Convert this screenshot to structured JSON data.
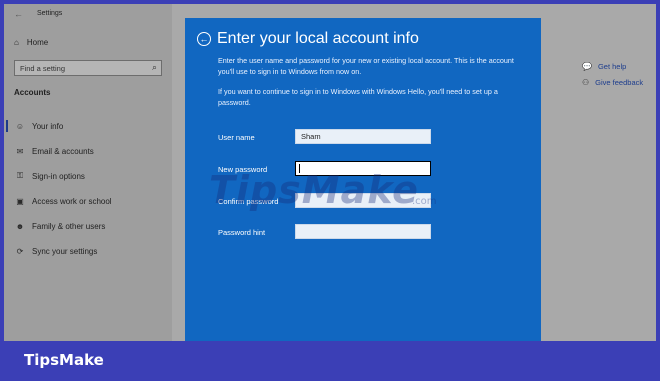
{
  "window": {
    "title": "Settings"
  },
  "sidebar": {
    "home_label": "Home",
    "search_placeholder": "Find a setting",
    "section_title": "Accounts",
    "items": [
      {
        "label": "Your info",
        "icon": "person-icon"
      },
      {
        "label": "Email & accounts",
        "icon": "email-icon"
      },
      {
        "label": "Sign-in options",
        "icon": "key-icon"
      },
      {
        "label": "Access work or school",
        "icon": "briefcase-icon"
      },
      {
        "label": "Family & other users",
        "icon": "people-icon"
      },
      {
        "label": "Sync your settings",
        "icon": "sync-icon"
      }
    ]
  },
  "help": {
    "get_help": "Get help",
    "give_feedback": "Give feedback"
  },
  "dialog": {
    "title": "Enter your local account info",
    "para1": "Enter the user name and password for your new or existing local account. This is the account you'll use to sign in to Windows from now on.",
    "para2": "If you want to continue to sign in to Windows with Windows Hello, you'll need to set up a password.",
    "fields": {
      "user_name": {
        "label": "User name",
        "value": "Sham"
      },
      "new_password": {
        "label": "New password",
        "value": ""
      },
      "confirm_password": {
        "label": "Confirm password",
        "value": ""
      },
      "password_hint": {
        "label": "Password hint",
        "value": ""
      }
    }
  },
  "watermark": {
    "text": "TipsMake",
    "suffix": ".com"
  },
  "brand": {
    "text": "TipsMake"
  },
  "colors": {
    "dialog_bg": "#1167c1",
    "frame_bg": "#3b3fb6"
  }
}
